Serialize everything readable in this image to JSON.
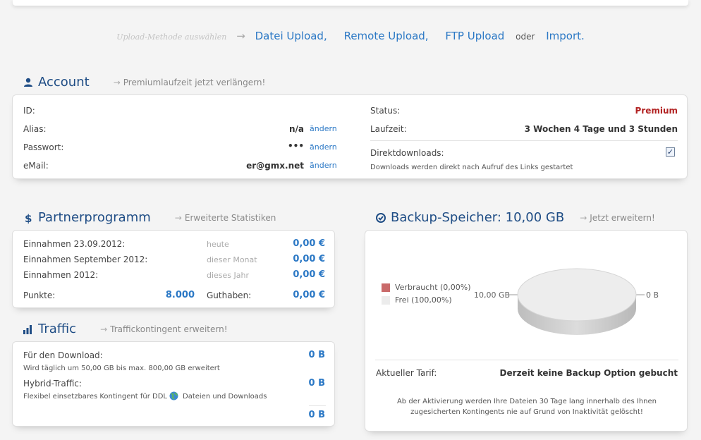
{
  "upload": {
    "hint": "Upload-Methode auswählen",
    "arrow": "→",
    "links": [
      "Datei Upload",
      "Remote Upload",
      "FTP Upload",
      "Import."
    ],
    "comma": ",",
    "oder": "oder"
  },
  "account": {
    "title": "Account",
    "sub_link": "Premiumlaufzeit jetzt verlängern!",
    "labels": {
      "id": "ID:",
      "alias": "Alias:",
      "password": "Passwort:",
      "email": "eMail:"
    },
    "values": {
      "alias": "n/a",
      "password": "•••",
      "email": "er@gmx.net"
    },
    "change_label": "ändern",
    "status_label": "Status:",
    "status_value": "Premium",
    "runtime_label": "Laufzeit:",
    "runtime_value": "3 Wochen 4 Tage und 3 Stunden",
    "direct_label": "Direktdownloads:",
    "direct_checked": true,
    "direct_note": "Downloads werden direkt nach Aufruf des Links gestartet"
  },
  "partner": {
    "title": "Partnerprogramm",
    "sub_link": "Erweiterte Statistiken",
    "rows": [
      {
        "label": "Einnahmen 23.09.2012:",
        "period": "heute",
        "value": "0,00 €"
      },
      {
        "label": "Einnahmen September 2012:",
        "period": "dieser Monat",
        "value": "0,00 €"
      },
      {
        "label": "Einnahmen 2012:",
        "period": "dieses Jahr",
        "value": "0,00 €"
      }
    ],
    "points_label": "Punkte:",
    "points_value": "8.000",
    "credit_label": "Guthaben:",
    "credit_value": "0,00 €"
  },
  "traffic": {
    "title": "Traffic",
    "sub_link": "Traffickontingent erweitern!",
    "download_label": "Für den Download:",
    "download_value": "0 B",
    "download_note": "Wird täglich um 50,00 GB bis max. 800,00 GB erweitert",
    "hybrid_label": "Hybrid-Traffic:",
    "hybrid_value": "0 B",
    "hybrid_note_a": "Flexibel einsetzbares Kontingent für DDL",
    "hybrid_note_b": "Dateien und Downloads",
    "total_value": "0 B"
  },
  "backup": {
    "title": "Backup-Speicher: 10,00 GB",
    "sub_link": "Jetzt erweitern!",
    "legend_used": "Verbraucht (0,00%)",
    "legend_free": "Frei (100,00%)",
    "label_left": "10,00 GB",
    "label_right": "0 B",
    "tariff_label": "Aktueller Tarif:",
    "tariff_value": "Derzeit keine Backup Option gebucht",
    "note_line1": "Ab der Aktivierung werden Ihre Dateien 30 Tage lang innerhalb des Ihnen",
    "note_line2": "zugesicherten Kontingents nie auf Grund von Inaktivität gelöscht!"
  },
  "colors": {
    "accent": "#2b78c5",
    "title": "#1f4d85",
    "premium": "#b22222",
    "used": "#c96a6a",
    "free": "#ececec"
  },
  "icons": {
    "account": "user-icon",
    "partner": "dollar-icon",
    "traffic": "bar-chart-icon",
    "backup": "check-circle-icon"
  }
}
